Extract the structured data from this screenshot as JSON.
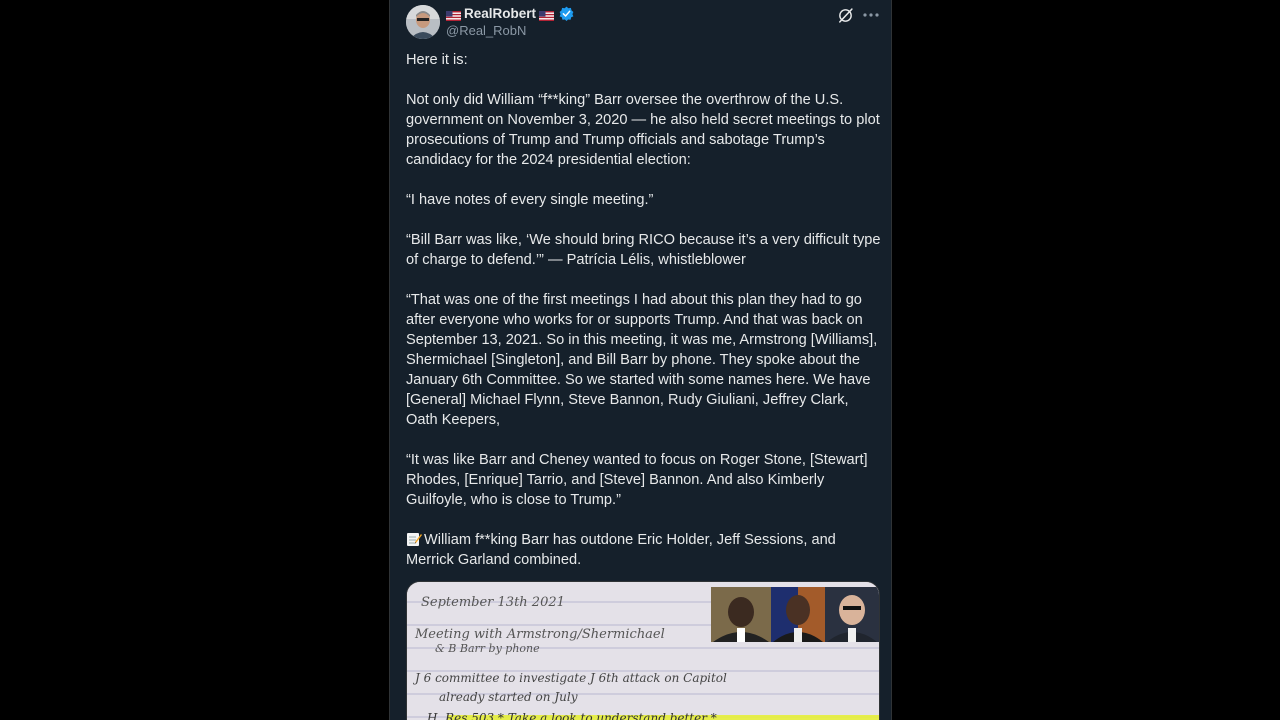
{
  "author": {
    "display_name": "RealRobert",
    "handle": "@Real_RobN",
    "verified": true
  },
  "icons": {
    "flag": "us-flag-icon",
    "verified": "verified-badge-icon",
    "grok": "grok-icon",
    "more": "more-options-icon",
    "memo": "memo-icon"
  },
  "colors": {
    "background": "#15202b",
    "text": "#e7e9ea",
    "secondary_text": "#8b98a5",
    "verified_blue": "#1d9bf0"
  },
  "post": {
    "p1": "Here it is:",
    "p2": "Not only did William “f**king” Barr oversee the overthrow of the U.S. government on November 3, 2020 — he also held secret meetings to plot prosecutions of Trump and Trump officials and sabotage Trump’s candidacy for the 2024 presidential election:",
    "p3": "“I have notes of every single meeting.”",
    "p4": "“Bill Barr was like, ‘We should bring RICO because it’s a very difficult type of charge to defend.’” — Patrícia Lélis, whistleblower",
    "p5": "“That was one of the first meetings I had about this plan they had to go after everyone who works for or supports Trump. And that was back on September 13, 2021. So in this meeting, it was me, Armstrong [Williams], Shermichael [Singleton], and Bill Barr by phone. They spoke about the January 6th Committee. So we started with some names here. We have [General] Michael Flynn, Steve Bannon, Rudy Giuliani, Jeffrey Clark, Oath Keepers,",
    "p6": "“It was like Barr and Cheney wanted to focus on Roger Stone, [Stewart] Rhodes, [Enrique] Tarrio, and [Steve] Bannon. And also Kimberly Guilfoyle, who is close to Trump.”",
    "p7": "William f**king Barr has outdone Eric Holder, Jeff Sessions, and Merrick Garland combined."
  },
  "media": {
    "notes": {
      "line1": "September 13th 2021",
      "line2": "Meeting with Armstrong/Shermichael",
      "line3": "& B Barr by phone",
      "line4": "J 6 committee to investigate J 6th attack on Capitol",
      "line5": "already started on July",
      "line6": "H. Res 503 * Take a look to understand better *"
    }
  }
}
